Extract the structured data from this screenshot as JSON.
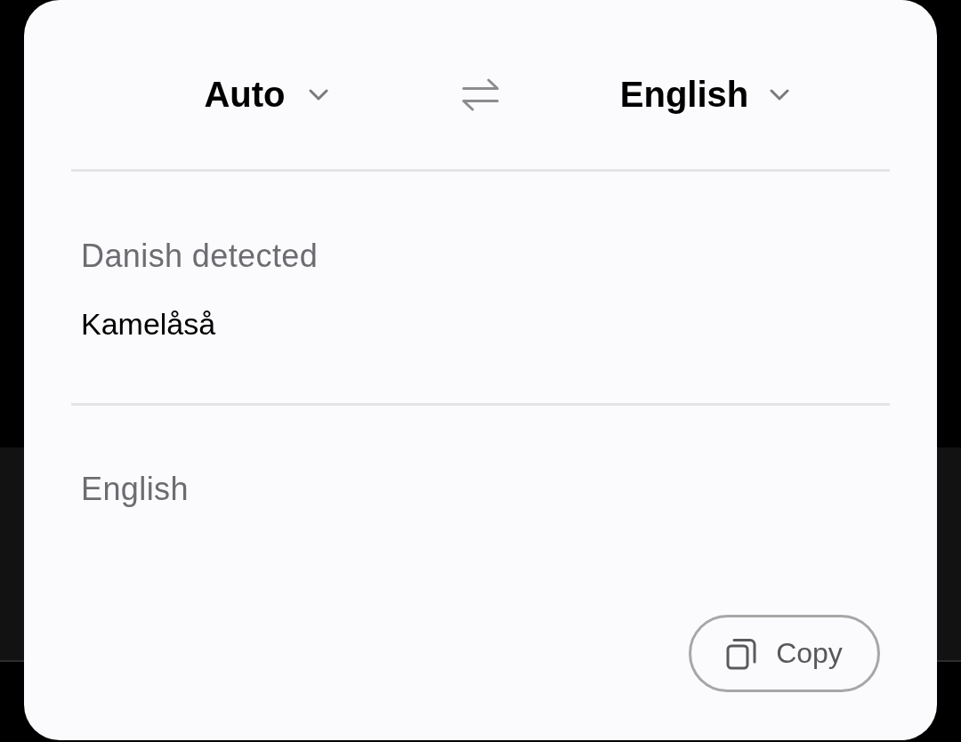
{
  "language_bar": {
    "source_language": {
      "label": "Auto"
    },
    "target_language": {
      "label": "English"
    }
  },
  "source_panel": {
    "detected_language": "Danish detected",
    "text": "Kamelåså"
  },
  "target_panel": {
    "language_label": "English"
  },
  "copy_button": {
    "label": "Copy"
  }
}
